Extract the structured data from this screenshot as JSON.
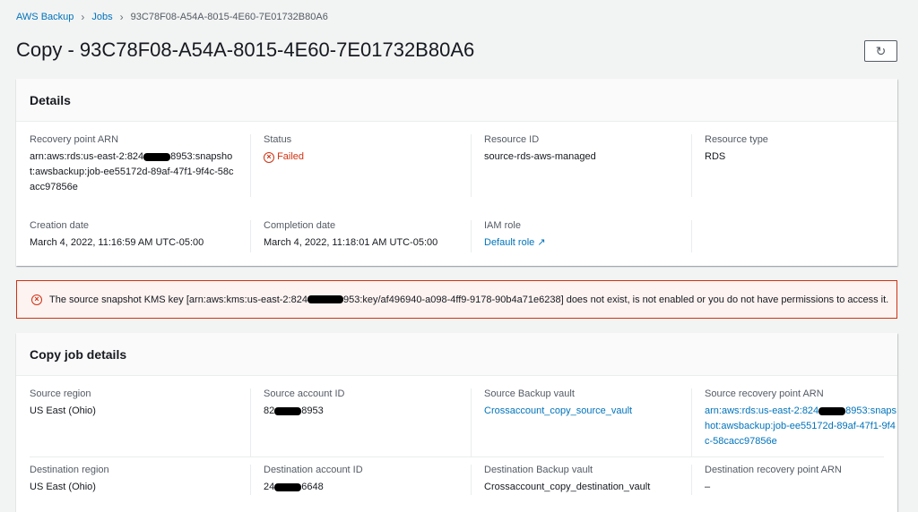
{
  "breadcrumb": [
    "AWS Backup",
    "Jobs",
    "93C78F08-A54A-8015-4E60-7E01732B80A6"
  ],
  "title": "Copy - 93C78F08-A54A-8015-4E60-7E01732B80A6",
  "details": {
    "heading": "Details",
    "recovery_point_arn": {
      "label": "Recovery point ARN",
      "pre": "arn:aws:rds:us-east-2:824",
      "post": "8953:snapshot:awsbackup:job-ee55172d-89af-47f1-9f4c-58cacc97856e"
    },
    "status": {
      "label": "Status",
      "value": "Failed"
    },
    "resource_id": {
      "label": "Resource ID",
      "value": "source-rds-aws-managed"
    },
    "resource_type": {
      "label": "Resource type",
      "value": "RDS"
    },
    "creation_date": {
      "label": "Creation date",
      "value": "March 4, 2022, 11:16:59 AM UTC-05:00"
    },
    "completion_date": {
      "label": "Completion date",
      "value": "March 4, 2022, 11:18:01 AM UTC-05:00"
    },
    "iam_role": {
      "label": "IAM role",
      "value": "Default role"
    }
  },
  "error": {
    "pre": "The source snapshot KMS key [arn:aws:kms:us-east-2:824",
    "post": "953:key/af496940-a098-4ff9-9178-90b4a71e6238] does not exist, is not enabled or you do not have permissions to access it."
  },
  "copy": {
    "heading": "Copy job details",
    "source_region": {
      "label": "Source region",
      "value": "US East (Ohio)"
    },
    "source_account": {
      "label": "Source account ID",
      "pre": "82",
      "post": "8953"
    },
    "source_vault": {
      "label": "Source Backup vault",
      "value": "Crossaccount_copy_source_vault"
    },
    "source_rp_arn": {
      "label": "Source recovery point ARN",
      "pre": "arn:aws:rds:us-east-2:824",
      "post": "8953:snapshot:awsbackup:job-ee55172d-89af-47f1-9f4c-58cacc97856e"
    },
    "dest_region": {
      "label": "Destination region",
      "value": "US East (Ohio)"
    },
    "dest_account": {
      "label": "Destination account ID",
      "pre": "24",
      "post": "6648"
    },
    "dest_vault": {
      "label": "Destination Backup vault",
      "value": "Crossaccount_copy_destination_vault"
    },
    "dest_rp_arn": {
      "label": "Destination recovery point ARN",
      "value": "–"
    }
  }
}
